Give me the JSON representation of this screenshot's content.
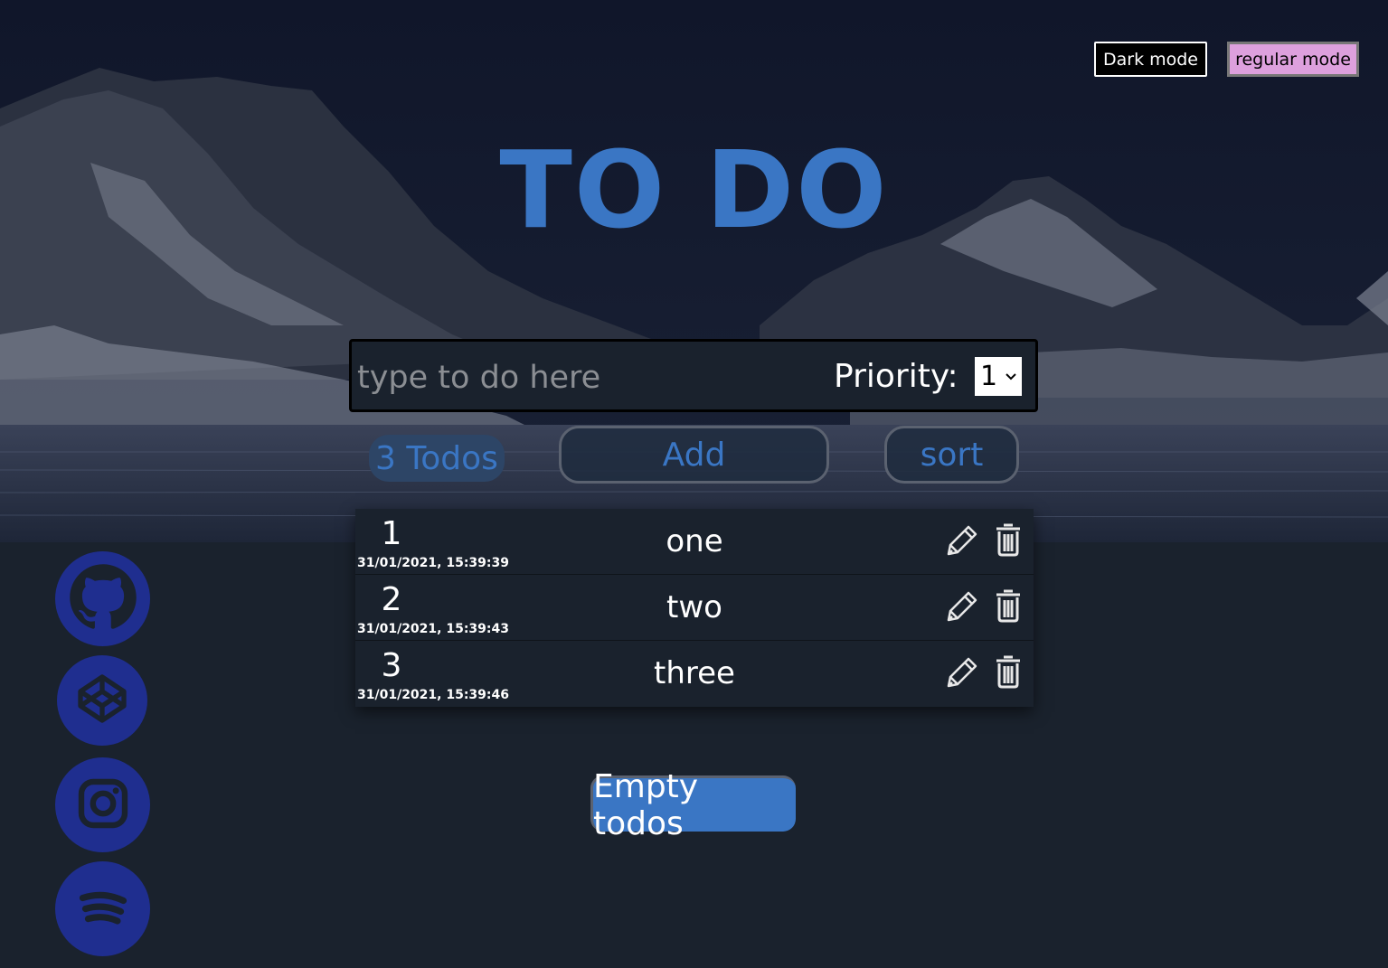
{
  "header": {
    "dark_mode_label": "Dark mode",
    "regular_mode_label": "regular mode",
    "title": "TO DO"
  },
  "input_bar": {
    "placeholder": "type to do here",
    "value": "",
    "priority_label": "Priority:",
    "priority_selected": "1"
  },
  "controls": {
    "count_label": "3 Todos",
    "add_label": "Add",
    "sort_label": "sort"
  },
  "todos": [
    {
      "priority": "1",
      "date": "31/01/2021, 15:39:39",
      "text": "one"
    },
    {
      "priority": "2",
      "date": "31/01/2021, 15:39:43",
      "text": "two"
    },
    {
      "priority": "3",
      "date": "31/01/2021, 15:39:46",
      "text": "three"
    }
  ],
  "footer": {
    "empty_label": "Empty todos"
  },
  "social": [
    {
      "icon": "github-icon"
    },
    {
      "icon": "codepen-icon"
    },
    {
      "icon": "instagram-icon"
    },
    {
      "icon": "spotify-icon"
    }
  ],
  "colors": {
    "accent": "#3a76c4",
    "page_background": "#1a222d",
    "social_circle": "#1f2e8f",
    "regular_mode_button": "#dda0dd"
  }
}
